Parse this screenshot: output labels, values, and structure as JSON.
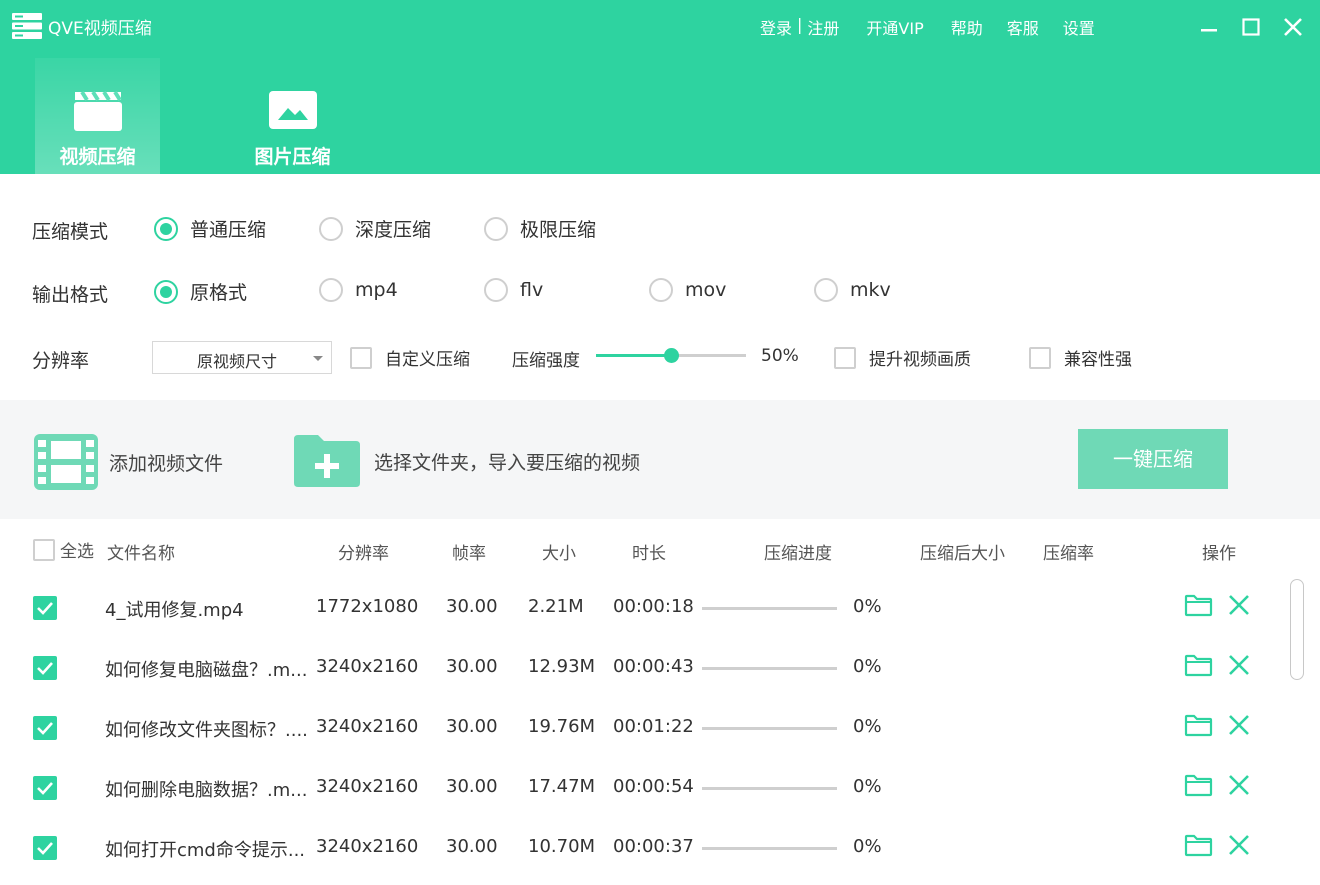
{
  "app": {
    "title": "QVE视频压缩"
  },
  "top_links": {
    "login": "登录",
    "separator": "|",
    "register": "注册",
    "vip": "开通VIP",
    "help": "帮助",
    "service": "客服",
    "settings": "设置"
  },
  "tabs": [
    {
      "label": "视频压缩",
      "active": true
    },
    {
      "label": "图片压缩",
      "active": false
    }
  ],
  "settings": {
    "mode": {
      "label": "压缩模式",
      "options": [
        "普通压缩",
        "深度压缩",
        "极限压缩"
      ],
      "selected": "普通压缩"
    },
    "format": {
      "label": "输出格式",
      "options": [
        "原格式",
        "mp4",
        "flv",
        "mov",
        "mkv"
      ],
      "selected": "原格式"
    },
    "resolution": {
      "label": "分辨率",
      "select_value": "原视频尺寸",
      "custom_label": "自定义压缩",
      "strength_label": "压缩强度",
      "strength_value": "50%",
      "strength_fraction": 0.5,
      "enhance_label": "提升视频画质",
      "compat_label": "兼容性强"
    }
  },
  "toolbar": {
    "add_file": "添加视频文件",
    "add_folder": "选择文件夹，导入要压缩的视频",
    "compress_all": "一键压缩"
  },
  "table": {
    "headers": {
      "select_all": "全选",
      "name": "文件名称",
      "resolution": "分辨率",
      "fps": "帧率",
      "size": "大小",
      "duration": "时长",
      "progress": "压缩进度",
      "compressed_size": "压缩后大小",
      "ratio": "压缩率",
      "actions": "操作"
    },
    "rows": [
      {
        "name": "4_试用修复.mp4",
        "resolution": "1772x1080",
        "fps": "30.00",
        "size": "2.21M",
        "duration": "00:00:18",
        "progress_text": "0%",
        "progress": 0
      },
      {
        "name": "如何修复电脑磁盘？.m...",
        "resolution": "3240x2160",
        "fps": "30.00",
        "size": "12.93M",
        "duration": "00:00:43",
        "progress_text": "0%",
        "progress": 0
      },
      {
        "name": "如何修改文件夹图标？....",
        "resolution": "3240x2160",
        "fps": "30.00",
        "size": "19.76M",
        "duration": "00:01:22",
        "progress_text": "0%",
        "progress": 0
      },
      {
        "name": "如何删除电脑数据？.m...",
        "resolution": "3240x2160",
        "fps": "30.00",
        "size": "17.47M",
        "duration": "00:00:54",
        "progress_text": "0%",
        "progress": 0
      },
      {
        "name": "如何打开cmd命令提示...",
        "resolution": "3240x2160",
        "fps": "30.00",
        "size": "10.70M",
        "duration": "00:00:37",
        "progress_text": "0%",
        "progress": 0
      }
    ]
  },
  "colors": {
    "accent": "#2ed3a0",
    "button": "#6fd9b6",
    "toolbar_bg": "#f5f6f7"
  }
}
